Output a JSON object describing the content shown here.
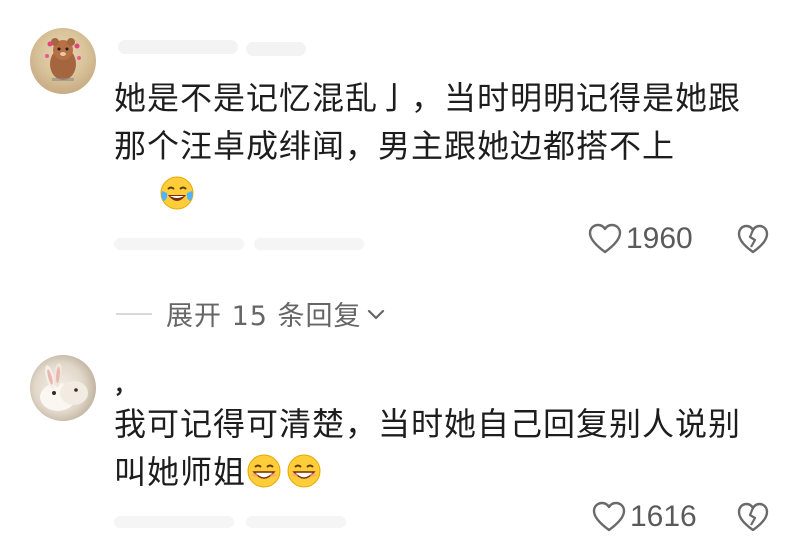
{
  "comments": [
    {
      "avatar_icon": "teddy-bear-avatar-icon",
      "text": "她是不是记忆混乱亅，当时明明记得是她跟那个汪卓成绯闻，男主跟她边都搭不上",
      "emoji": "laughing-crying-emoji",
      "likes": "1960",
      "like_icon": "heart-outline-icon",
      "dislike_icon": "broken-heart-outline-icon"
    },
    {
      "avatar_icon": "rabbit-avatar-icon",
      "username_mark": "，",
      "text": "我可记得可清楚，当时她自己回复别人说别叫她师姐",
      "emojis": [
        "grinning-emoji",
        "grinning-emoji"
      ],
      "likes": "1616",
      "like_icon": "heart-outline-icon",
      "dislike_icon": "broken-heart-outline-icon"
    }
  ],
  "replies": {
    "expand_label": "展开 15 条回复",
    "chevron_icon": "chevron-down-icon"
  },
  "colors": {
    "text": "#1d1d1d",
    "meta": "#5a5a5a",
    "expand": "#666666"
  }
}
